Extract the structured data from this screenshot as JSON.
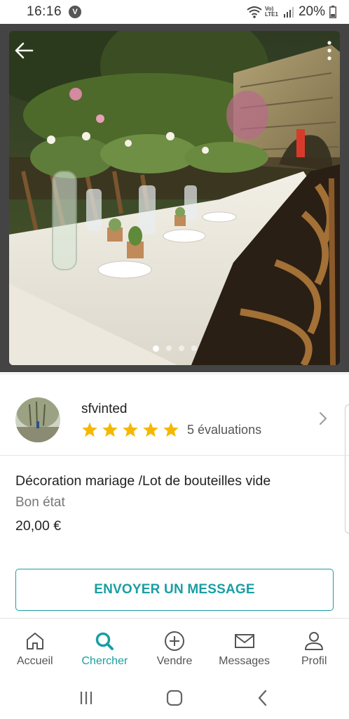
{
  "status_bar": {
    "time": "16:16",
    "carrier_badge": "V",
    "network_label": "Vo) LTE1",
    "battery": "20%"
  },
  "listing": {
    "photo_count": 4,
    "active_photo": 1
  },
  "seller": {
    "username": "sfvinted",
    "stars": 5,
    "reviews": "5 évaluations"
  },
  "item": {
    "title": "Décoration mariage /Lot de bouteilles vide",
    "condition": "Bon état",
    "price": "20,00 €"
  },
  "actions": {
    "message_label": "ENVOYER UN MESSAGE"
  },
  "bottom_nav": {
    "items": [
      {
        "label": "Accueil",
        "icon": "home-icon"
      },
      {
        "label": "Chercher",
        "icon": "search-icon"
      },
      {
        "label": "Vendre",
        "icon": "plus-circle-icon"
      },
      {
        "label": "Messages",
        "icon": "mail-icon"
      },
      {
        "label": "Profil",
        "icon": "user-icon"
      }
    ],
    "active": "Chercher"
  },
  "colors": {
    "accent": "#1a9ea3",
    "star": "#f5b800"
  }
}
